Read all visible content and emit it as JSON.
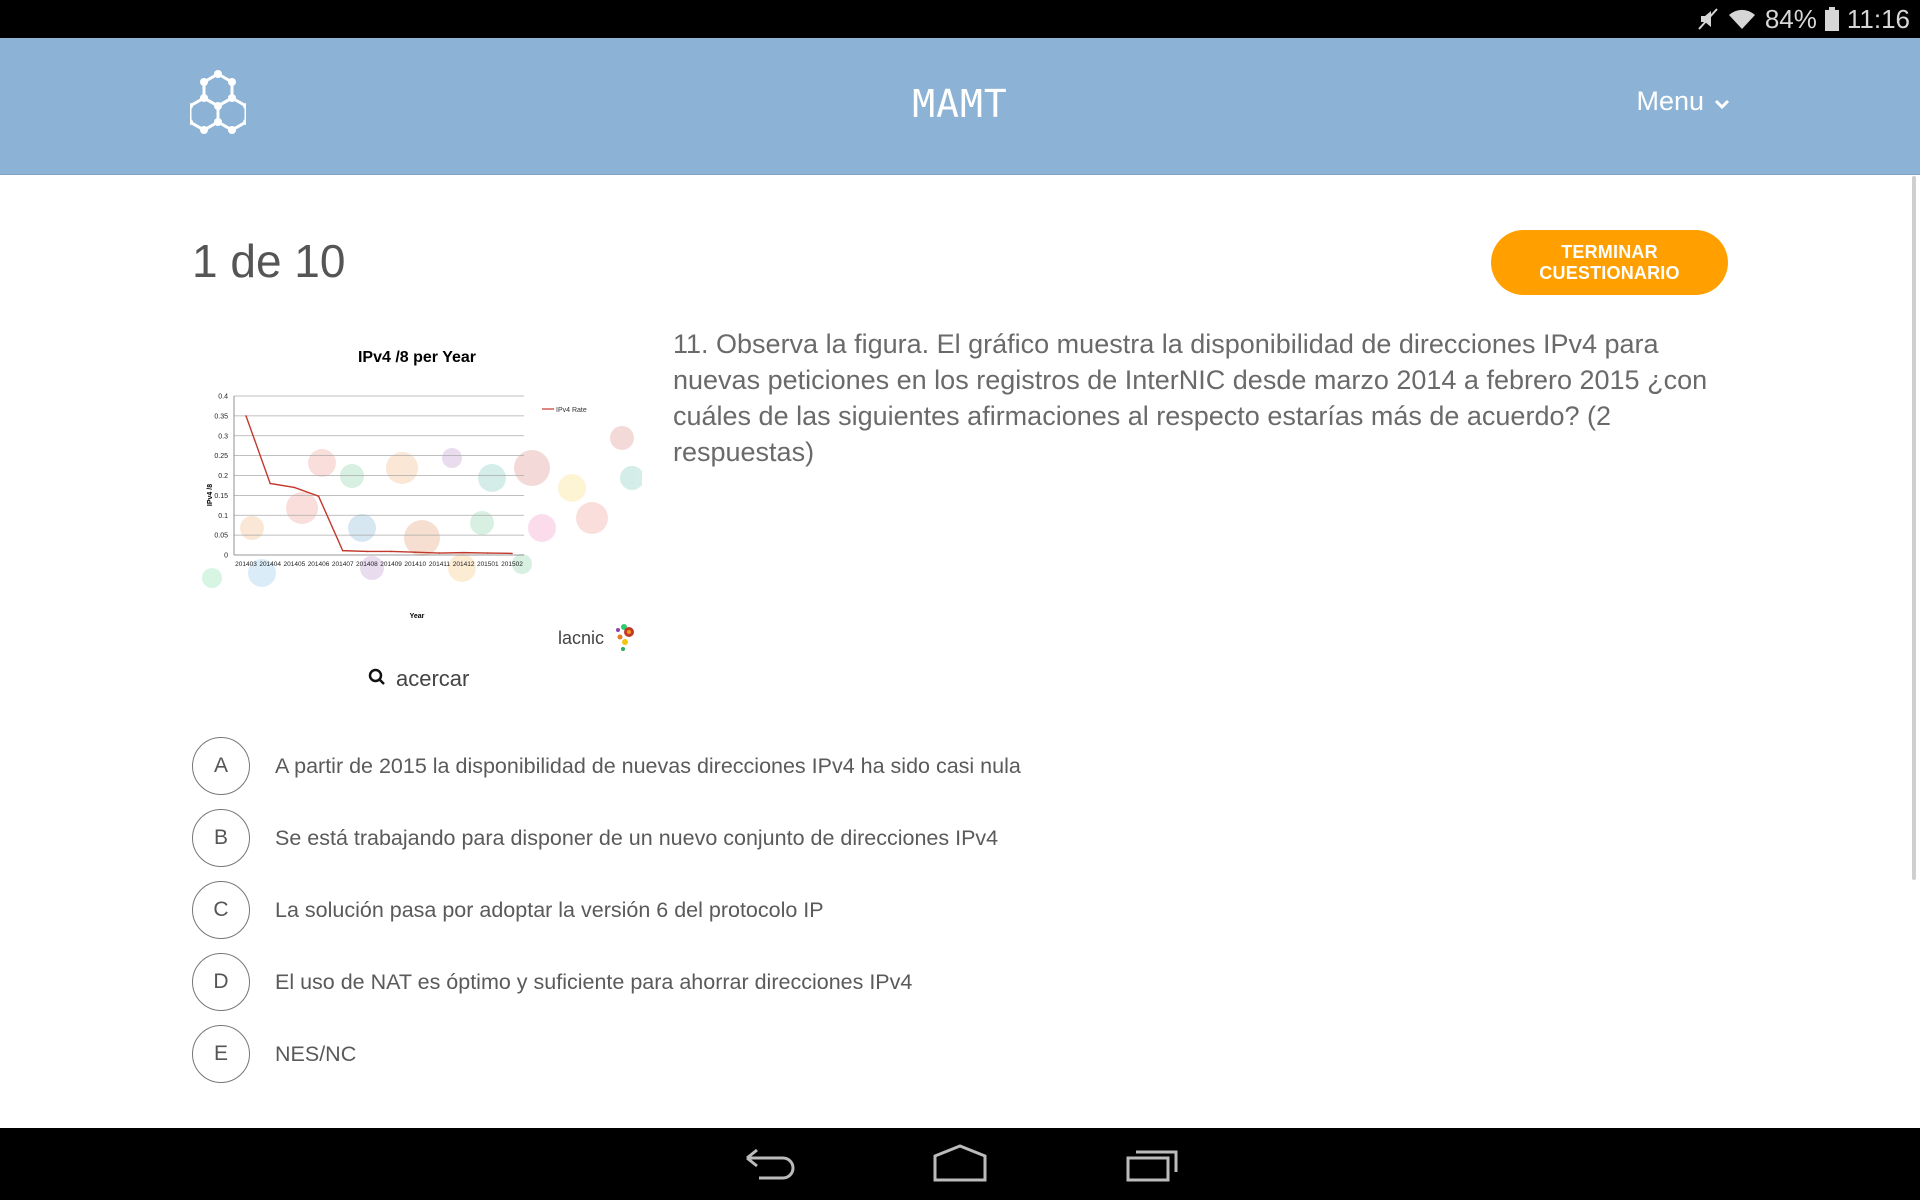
{
  "status_bar": {
    "battery": "84%",
    "time": "11:16"
  },
  "header": {
    "title": "MAMT",
    "menu_label": "Menu"
  },
  "quiz": {
    "progress": "1 de 10",
    "finish_label": "TERMINAR CUESTIONARIO",
    "question": "11. Observa la figura. El gráfico muestra la disponibilidad de direcciones IPv4 para nuevas peticiones en los registros de InterNIC desde marzo 2014 a febrero 2015 ¿con cuáles de las siguientes afirmaciones al respecto estarías más de acuerdo? (2 respuestas)",
    "zoom_label": "acercar",
    "options": [
      {
        "letter": "A",
        "text": "A partir de 2015 la disponibilidad de nuevas direcciones IPv4 ha sido casi nula"
      },
      {
        "letter": "B",
        "text": "Se está trabajando para disponer de un nuevo conjunto de direcciones IPv4"
      },
      {
        "letter": "C",
        "text": "La solución pasa por adoptar la versión 6 del protocolo IP"
      },
      {
        "letter": "D",
        "text": "El uso de NAT es óptimo y suficiente para ahorrar direcciones IPv4"
      },
      {
        "letter": "E",
        "text": "NES/NC"
      }
    ]
  },
  "figure": {
    "watermark": "lacnic"
  },
  "chart_data": {
    "type": "line",
    "title": "IPv4 /8 per Year",
    "xlabel": "Year",
    "ylabel": "IPv4 /8",
    "categories": [
      "201403",
      "201404",
      "201405",
      "201406",
      "201407",
      "201408",
      "201409",
      "201410",
      "201411",
      "201412",
      "201501",
      "201502"
    ],
    "series": [
      {
        "name": "IPv4 Rate",
        "values": [
          0.35,
          0.18,
          0.17,
          0.148,
          0.011,
          0.009,
          0.009,
          0.007,
          0.005,
          0.006,
          0.005,
          0.004
        ]
      }
    ],
    "yticks": [
      "0",
      "0.05",
      "0.1",
      "0.15",
      "0.2",
      "0.25",
      "0.3",
      "0.35",
      "0.4"
    ],
    "ylim": [
      0,
      0.4
    ],
    "grid": true,
    "legend": "top-right",
    "line_color": "#c0392b"
  }
}
